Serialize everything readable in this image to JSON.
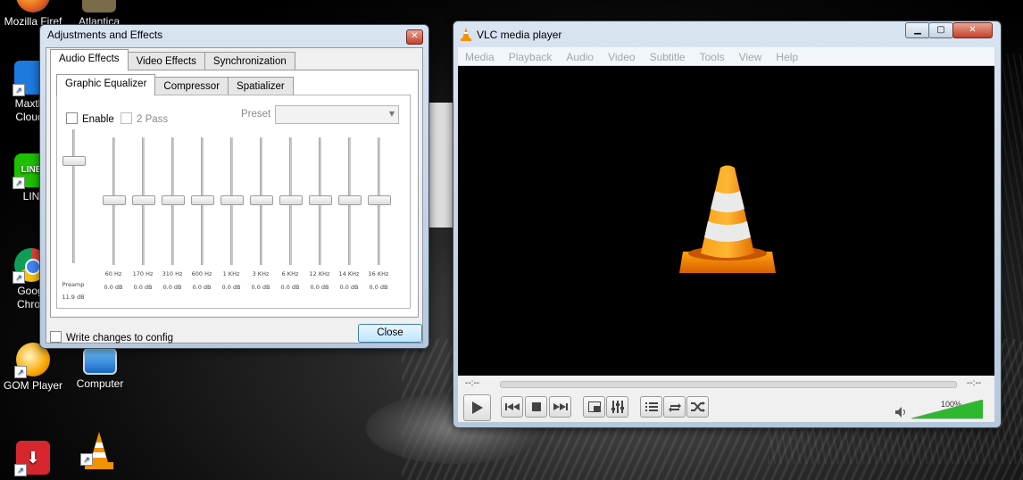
{
  "desktop": {
    "icons": [
      {
        "label": "Mozilla Firef",
        "icon": "firefox-icon"
      },
      {
        "label": "Atlantica",
        "icon": "atlantica-icon"
      },
      {
        "label": "Maxth Cloud",
        "icon": "maxthon-icon"
      },
      {
        "label": "LIN",
        "icon": "line-icon"
      },
      {
        "label": "Goog Chror",
        "icon": "chrome-icon"
      },
      {
        "label": "GOM Player",
        "icon": "gom-player-icon"
      },
      {
        "label": "Computer",
        "icon": "computer-icon"
      },
      {
        "label": "",
        "icon": "downloader-icon"
      },
      {
        "label": "",
        "icon": "vlc-cone-icon"
      }
    ]
  },
  "adjust_dialog": {
    "title": "Adjustments and Effects",
    "main_tabs": [
      "Audio Effects",
      "Video Effects",
      "Synchronization"
    ],
    "sub_tabs": [
      "Graphic Equalizer",
      "Compressor",
      "Spatializer"
    ],
    "enable_label": "Enable",
    "two_pass_label": "2 Pass",
    "preset_label": "Preset",
    "preset_value": "",
    "preamp": {
      "label": "Preamp",
      "value": "11.9 dB"
    },
    "bands": [
      {
        "freq": "60 Hz",
        "value": "0.0 dB"
      },
      {
        "freq": "170 Hz",
        "value": "0.0 dB"
      },
      {
        "freq": "310 Hz",
        "value": "0.0 dB"
      },
      {
        "freq": "600 Hz",
        "value": "0.0 dB"
      },
      {
        "freq": "1 KHz",
        "value": "0.0 dB"
      },
      {
        "freq": "3 KHz",
        "value": "0.0 dB"
      },
      {
        "freq": "6 KHz",
        "value": "0.0 dB"
      },
      {
        "freq": "12 KHz",
        "value": "0.0 dB"
      },
      {
        "freq": "14 KHz",
        "value": "0.0 dB"
      },
      {
        "freq": "16 KHz",
        "value": "0.0 dB"
      }
    ],
    "write_config_label": "Write changes to config",
    "close_label": "Close"
  },
  "vlc": {
    "title": "VLC media player",
    "menu": [
      "Media",
      "Playback",
      "Audio",
      "Video",
      "Subtitle",
      "Tools",
      "View",
      "Help"
    ],
    "elapsed": "--:--",
    "remaining": "--:--",
    "volume_label": "100%",
    "volume": 1.0
  },
  "colors": {
    "vlc_orange": "#f39200",
    "volume_green": "#2eb82e",
    "button_blue": "#3c7fb1"
  }
}
